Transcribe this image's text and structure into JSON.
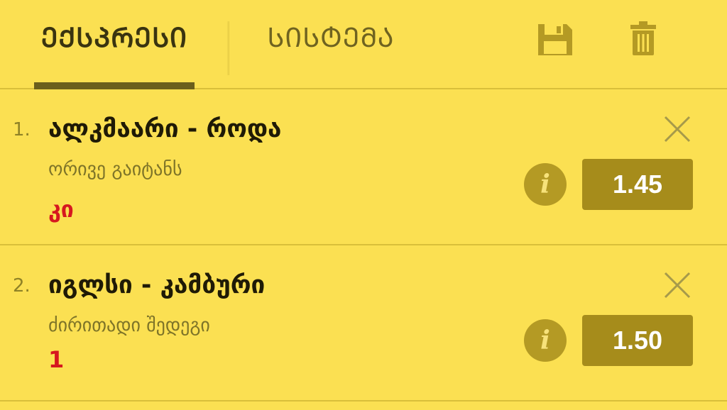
{
  "header": {
    "tabs": [
      {
        "label": "ᲔᲥᲡᲞᲠᲔᲡᲘ",
        "active": true
      },
      {
        "label": "ᲡᲘᲡᲢᲔᲛᲐ",
        "active": false
      }
    ],
    "icons": [
      "save-icon",
      "trash-icon"
    ]
  },
  "bets": [
    {
      "number": "1.",
      "match": "ალკმაარი - როდა",
      "market": "ორივე გაიტანს",
      "pick": "კი",
      "odd": "1.45"
    },
    {
      "number": "2.",
      "match": "იგლსი - კამბური",
      "market": "ძირითადი შედეგი",
      "pick": "1",
      "odd": "1.50"
    }
  ],
  "colors": {
    "background": "#fbe052",
    "accent": "#a68c1b",
    "pick": "#d6181f",
    "tab_underline": "#6b5f1c"
  }
}
